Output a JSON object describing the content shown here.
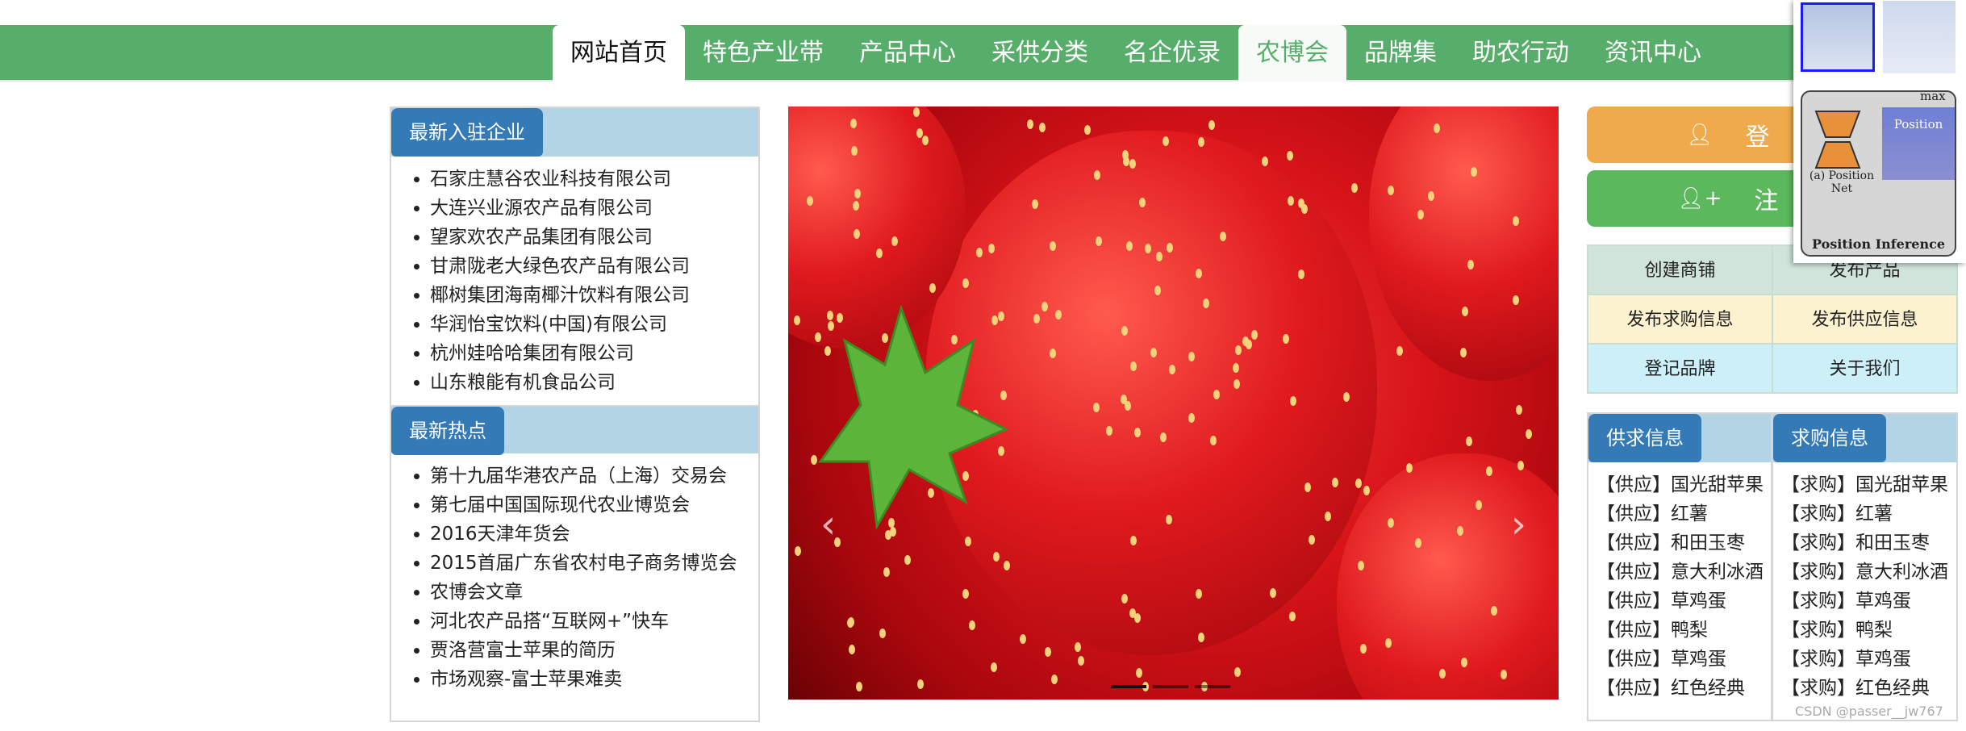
{
  "nav": {
    "tabs": [
      "网站首页",
      "特色产业带",
      "产品中心",
      "采供分类",
      "名企优录",
      "农博会",
      "品牌集",
      "助农行动",
      "资讯中心"
    ],
    "active": "网站首页",
    "selected": "农博会"
  },
  "left": {
    "companies": {
      "title": "最新入驻企业",
      "items": [
        "石家庄慧谷农业科技有限公司",
        "大连兴业源农产品有限公司",
        "望家欢农产品集团有限公司",
        "甘肃陇老大绿色农产品有限公司",
        "椰树集团海南椰汁饮料有限公司",
        "华润怡宝饮料(中国)有限公司",
        "杭州娃哈哈集团有限公司",
        "山东粮能有机食品公司"
      ]
    },
    "hot": {
      "title": "最新热点",
      "items": [
        "第十九届华港农产品（上海）交易会",
        "第七届中国国际现代农业博览会",
        "2016天津年货会",
        "2015首届广东省农村电子商务博览会",
        "农博会文章",
        "河北农产品搭“互联网+”快车",
        "贾洛营富士苹果的简历",
        "市场观察-富士苹果难卖"
      ]
    }
  },
  "carousel": {
    "prev": "‹",
    "next": "›",
    "indicators": 3,
    "active_index": 0
  },
  "right": {
    "login": "登录",
    "register": "注册",
    "grid": [
      "创建商铺",
      "发布产品",
      "发布求购信息",
      "发布供应信息",
      "登记品牌",
      "关于我们"
    ],
    "supply": {
      "title": "供求信息",
      "prefix": "【供应】",
      "items": [
        "国光甜苹果",
        "红薯",
        "和田玉枣",
        "意大利冰酒",
        "草鸡蛋",
        "鸭梨",
        "草鸡蛋",
        "红色经典"
      ]
    },
    "demand": {
      "title": "求购信息",
      "prefix": "【求购】",
      "items": [
        "国光甜苹果",
        "红薯",
        "和田玉枣",
        "意大利冰酒",
        "草鸡蛋",
        "鸭梨",
        "草鸡蛋",
        "红色经典"
      ]
    }
  },
  "overlay": {
    "max": "max",
    "position": "Position",
    "net_label": "(a) Position Net",
    "caption": "Position Inference"
  },
  "watermark": "CSDN @passer__jw767",
  "colors": {
    "nav": "#57ae6a",
    "label": "#337ab7",
    "band": "#b3d4e5",
    "login": "#efaa4b",
    "register": "#5cb85c"
  }
}
